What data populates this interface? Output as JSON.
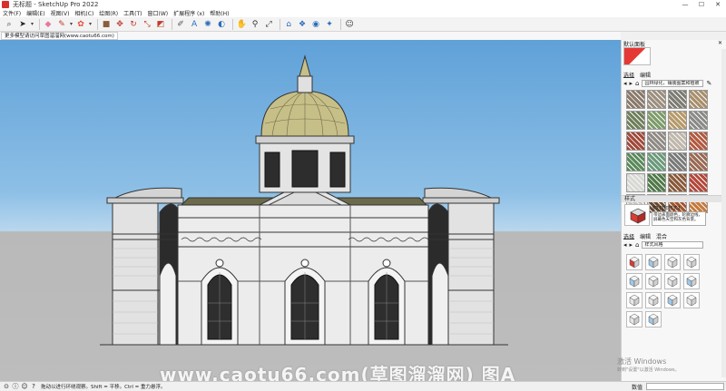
{
  "window": {
    "title": "无标题 - SketchUp Pro 2022",
    "controls": [
      "—",
      "☐",
      "✕"
    ]
  },
  "menu": [
    "文件(F)",
    "编辑(E)",
    "视图(V)",
    "相机(C)",
    "绘图(R)",
    "工具(T)",
    "窗口(W)",
    "扩展程序 (x)",
    "帮助(H)"
  ],
  "toolbar": {
    "tools": [
      {
        "name": "search-icon",
        "glyph": "⌕",
        "color": "#444"
      },
      {
        "name": "select-arrow-icon",
        "glyph": "➤",
        "color": "#222"
      },
      {
        "name": "eraser-icon",
        "glyph": "◆",
        "color": "#e57aa0"
      },
      {
        "name": "pencil-icon",
        "glyph": "✎",
        "color": "#c0392b"
      },
      {
        "name": "shapes-icon",
        "glyph": "✿",
        "color": "#e74c3c"
      },
      {
        "name": "push-pull-icon",
        "glyph": "■",
        "color": "#8b5e3c"
      },
      {
        "name": "move-icon",
        "glyph": "✥",
        "color": "#c0392b"
      },
      {
        "name": "rotate-icon",
        "glyph": "↻",
        "color": "#c0392b"
      },
      {
        "name": "scale-icon",
        "glyph": "⤡",
        "color": "#c0392b"
      },
      {
        "name": "offset-icon",
        "glyph": "◩",
        "color": "#c0392b"
      },
      {
        "name": "tape-measure-icon",
        "glyph": "✐",
        "color": "#555"
      },
      {
        "name": "text-icon",
        "glyph": "A",
        "color": "#2a6ebb"
      },
      {
        "name": "paint-bucket-icon",
        "glyph": "✺",
        "color": "#2a6ebb"
      },
      {
        "name": "orbit-icon",
        "glyph": "◐",
        "color": "#2a6ebb"
      },
      {
        "name": "pan-icon",
        "glyph": "✋",
        "color": "#c08a30"
      },
      {
        "name": "zoom-icon",
        "glyph": "⚲",
        "color": "#333"
      },
      {
        "name": "zoom-extents-icon",
        "glyph": "⤢",
        "color": "#333"
      },
      {
        "name": "warehouse-icon",
        "glyph": "⌂",
        "color": "#2a6ebb"
      },
      {
        "name": "extension-warehouse-icon",
        "glyph": "❖",
        "color": "#2a6ebb"
      },
      {
        "name": "layout-icon",
        "glyph": "◉",
        "color": "#2a6ebb"
      },
      {
        "name": "style-builder-icon",
        "glyph": "✦",
        "color": "#2a6ebb"
      },
      {
        "name": "account-icon",
        "glyph": "☺",
        "color": "#333"
      }
    ]
  },
  "tab": {
    "label": "更多模型请访问草图溜溜网(www.caotu66.com)"
  },
  "watermark": "www.caotu66.com(草图溜溜网) 图A",
  "tray": {
    "materials_title": "默认面板",
    "subtabs": [
      "选择",
      "编辑"
    ],
    "library": "园林绿化，铺装图案和植被",
    "materials": [
      "#8b7a6a",
      "#9c8f7e",
      "#7c7c72",
      "#a88f6c",
      "#6f7f5a",
      "#7d9c6a",
      "#b59a6a",
      "#8a8a86",
      "#a04a3a",
      "#8f8a84",
      "#c0b8ac",
      "#b25a40",
      "#5a8a5a",
      "#6a9a7a",
      "#7a7a7a",
      "#9a6a54",
      "#d8d8d4",
      "#507a4a",
      "#8a5a3a",
      "#b4483a",
      "#c8c4bc",
      "#6a4a30",
      "#a0552e",
      "#c67a3a"
    ],
    "styles_head": "样式",
    "style_name": "3D 打印样式1",
    "style_desc": "带边表面颜色，轮廓边线，屏幕色天空和灰色背景。",
    "style_subtabs": [
      "选择",
      "编辑",
      "混合"
    ],
    "style_library": "样式风格"
  },
  "status": {
    "text": "拖动以进行环绕观察。Shift = 平移。Ctrl = 重力悬浮。",
    "measure_label": "数值"
  },
  "activation": {
    "title": "激活 Windows",
    "sub": "转到\"设置\"以激活 Windows。"
  }
}
